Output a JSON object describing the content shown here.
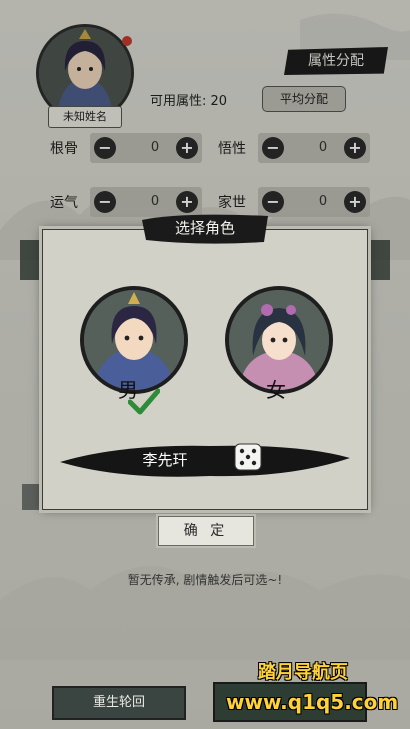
{
  "avatar": {
    "name": "未知姓名",
    "icon": "character-portrait-icon"
  },
  "attributes": {
    "title": "属性分配",
    "available_label": "可用属性: 20",
    "average_button": "平均分配",
    "stats": [
      {
        "label": "根骨",
        "value": "0"
      },
      {
        "label": "悟性",
        "value": "0"
      },
      {
        "label": "运气",
        "value": "0"
      },
      {
        "label": "家世",
        "value": "0"
      }
    ]
  },
  "modal": {
    "title": "选择角色",
    "male_label": "男",
    "female_label": "女",
    "selected": "male",
    "character_name": "李先玕",
    "confirm": "确 定"
  },
  "inheritance_hint": "暂无传承, 剧情触发后可选~!",
  "bottom": {
    "rebirth": "重生轮回"
  },
  "watermark": {
    "line1": "踏月导航页",
    "line2": "www.q1q5.com"
  },
  "colors": {
    "ink": "#1d1d1d",
    "paper": "#d2d1c8",
    "check_green": "#2e8b3a",
    "watermark": "#ffd23a"
  }
}
